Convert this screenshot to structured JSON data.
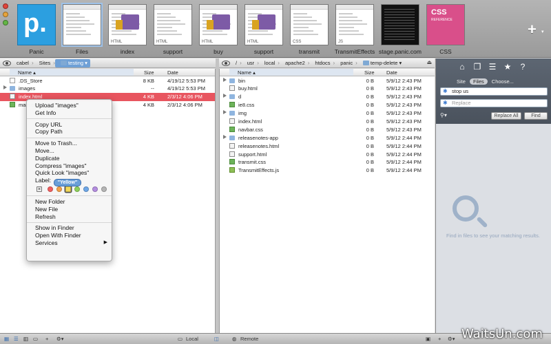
{
  "tabs": [
    {
      "label": "Panic",
      "kind": "panic"
    },
    {
      "label": "Files",
      "kind": "blank",
      "selected": true
    },
    {
      "label": "index",
      "kind": "truck",
      "tag": "HTML"
    },
    {
      "label": "support",
      "kind": "doc",
      "tag": "HTML"
    },
    {
      "label": "buy",
      "kind": "truck",
      "tag": "HTML"
    },
    {
      "label": "support",
      "kind": "truck",
      "tag": "HTML"
    },
    {
      "label": "transmit",
      "kind": "doc",
      "tag": "CSS"
    },
    {
      "label": "TransmitEffects",
      "kind": "doc",
      "tag": "JS"
    },
    {
      "label": "stage.panic.com",
      "kind": "dark"
    },
    {
      "label": "CSS",
      "kind": "css"
    }
  ],
  "css_tab_logo": {
    "title": "CSS",
    "sub": "REFERENCE"
  },
  "panic_logo": "p.",
  "add_tab": "+",
  "local": {
    "path": [
      "cabel",
      "Sites",
      "testing"
    ],
    "headers": {
      "name": "Name",
      "size": "Size",
      "date": "Date"
    },
    "rows": [
      {
        "name": ".DS_Store",
        "size": "8 KB",
        "date": "4/19/12 5:53 PM",
        "type": "file",
        "disc": false
      },
      {
        "name": "images",
        "size": "--",
        "date": "4/19/12 5:53 PM",
        "type": "folder",
        "disc": true
      },
      {
        "name": "index.html",
        "size": "4 KB",
        "date": "2/3/12 4:06 PM",
        "type": "html",
        "disc": false,
        "selected": true
      },
      {
        "name": "main.css",
        "size": "4 KB",
        "date": "2/3/12 4:06 PM",
        "type": "css",
        "disc": false
      }
    ]
  },
  "remote": {
    "path": [
      "/",
      "usr",
      "local",
      "apache2",
      "htdocs",
      "panic",
      "temp-delete"
    ],
    "headers": {
      "name": "Name",
      "size": "Size",
      "date": "Date"
    },
    "rows": [
      {
        "name": "bin",
        "size": "0 B",
        "date": "5/9/12 2:43 PM",
        "type": "folder",
        "disc": true
      },
      {
        "name": "buy.html",
        "size": "0 B",
        "date": "5/9/12 2:43 PM",
        "type": "html",
        "disc": false
      },
      {
        "name": "d",
        "size": "0 B",
        "date": "5/9/12 2:43 PM",
        "type": "folder",
        "disc": true
      },
      {
        "name": "ie8.css",
        "size": "0 B",
        "date": "5/9/12 2:43 PM",
        "type": "css",
        "disc": false
      },
      {
        "name": "img",
        "size": "0 B",
        "date": "5/9/12 2:43 PM",
        "type": "folder",
        "disc": true
      },
      {
        "name": "index.html",
        "size": "0 B",
        "date": "5/9/12 2:43 PM",
        "type": "html",
        "disc": false
      },
      {
        "name": "navbar.css",
        "size": "0 B",
        "date": "5/9/12 2:43 PM",
        "type": "css",
        "disc": false
      },
      {
        "name": "releasenotes-app",
        "size": "0 B",
        "date": "5/9/12 2:44 PM",
        "type": "folder",
        "disc": true
      },
      {
        "name": "releasenotes.html",
        "size": "0 B",
        "date": "5/9/12 2:44 PM",
        "type": "html",
        "disc": false
      },
      {
        "name": "support.html",
        "size": "0 B",
        "date": "5/9/12 2:44 PM",
        "type": "html",
        "disc": false
      },
      {
        "name": "transmit.css",
        "size": "0 B",
        "date": "5/9/12 2:44 PM",
        "type": "css",
        "disc": false
      },
      {
        "name": "TransmitEffects.js",
        "size": "0 B",
        "date": "5/9/12 2:44 PM",
        "type": "js",
        "disc": false
      }
    ]
  },
  "context_menu": {
    "upload": "Upload \"images\"",
    "get_info": "Get Info",
    "copy_url": "Copy URL",
    "copy_path": "Copy Path",
    "move_to_trash": "Move to Trash...",
    "move": "Move...",
    "duplicate": "Duplicate",
    "compress": "Compress \"images\"",
    "quick_look": "Quick Look \"images\"",
    "label": "Label:",
    "label_colors": [
      "#f16060",
      "#f2a14b",
      "#f2d95a",
      "#8ed05a",
      "#6fa8e8",
      "#b48ee0",
      "#b5b5b5"
    ],
    "new_folder": "New Folder",
    "new_file": "New File",
    "refresh": "Refresh",
    "show_in_finder": "Show in Finder",
    "open_with_finder": "Open With Finder",
    "services": "Services",
    "tooltip": "\"Yellow\""
  },
  "sidebar": {
    "seg_site": "Site",
    "seg_files": "Files",
    "seg_choose": "Choose...",
    "search_value": "stop us",
    "replace_placeholder": "Replace",
    "replace_all": "Replace All",
    "find": "Find",
    "empty_text": "Find in files to see your matching results."
  },
  "bottom": {
    "local": "Local",
    "remote": "Remote"
  },
  "watermark": "WaitsUn.com"
}
